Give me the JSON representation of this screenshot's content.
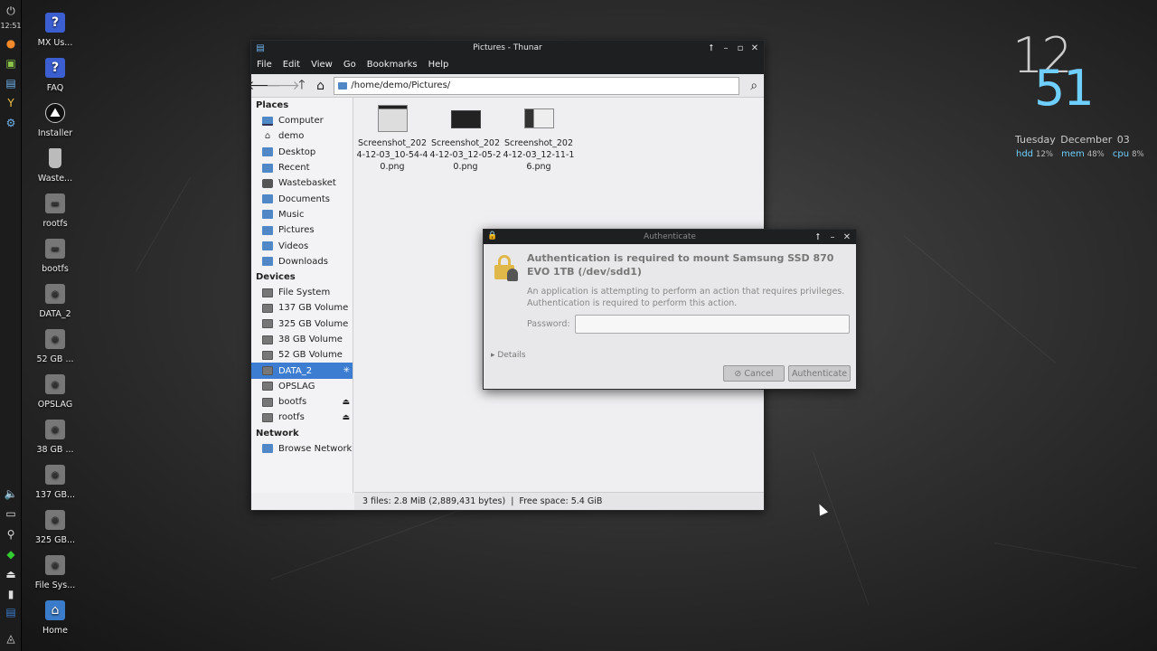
{
  "panel": {
    "clock": "12:51"
  },
  "desktop_icons": [
    {
      "label": "MX Us...",
      "icon": "help-icon",
      "glyph": "?"
    },
    {
      "label": "FAQ",
      "icon": "help-icon",
      "glyph": "?"
    },
    {
      "label": "Installer",
      "icon": "installer-icon",
      "glyph": "⛰"
    },
    {
      "label": "Waste...",
      "icon": "wastebasket-icon",
      "glyph": ""
    },
    {
      "label": "rootfs",
      "icon": "drive-icon",
      "glyph": "▬"
    },
    {
      "label": "bootfs",
      "icon": "drive-icon",
      "glyph": "▬"
    },
    {
      "label": "DATA_2",
      "icon": "drive-icon",
      "glyph": "◉"
    },
    {
      "label": "52 GB ...",
      "icon": "drive-icon",
      "glyph": "◉"
    },
    {
      "label": "OPSLAG",
      "icon": "drive-icon",
      "glyph": "◉"
    },
    {
      "label": "38 GB ...",
      "icon": "drive-icon",
      "glyph": "◉"
    },
    {
      "label": "137 GB...",
      "icon": "drive-icon",
      "glyph": "◉"
    },
    {
      "label": "325 GB...",
      "icon": "drive-icon",
      "glyph": "◉"
    },
    {
      "label": "File Sys...",
      "icon": "drive-icon",
      "glyph": "◉"
    },
    {
      "label": "Home",
      "icon": "home-folder-icon",
      "glyph": "⌂"
    }
  ],
  "conky": {
    "hour": "12",
    "minute": "51",
    "weekday": "Tuesday",
    "date": "December 03",
    "hdd_label": "hdd",
    "hdd_value": "12%",
    "mem_label": "mem",
    "mem_value": "48%",
    "cpu_label": "cpu",
    "cpu_value": "8%"
  },
  "thunar": {
    "title": "Pictures - Thunar",
    "menu": [
      "File",
      "Edit",
      "View",
      "Go",
      "Bookmarks",
      "Help"
    ],
    "location": "/home/demo/Pictures/",
    "sidebar": {
      "places_header": "Places",
      "places": [
        {
          "label": "Computer",
          "icon": "computer-icon"
        },
        {
          "label": "demo",
          "icon": "home-icon"
        },
        {
          "label": "Desktop",
          "icon": "folder-icon"
        },
        {
          "label": "Recent",
          "icon": "folder-icon"
        },
        {
          "label": "Wastebasket",
          "icon": "wastebasket-icon"
        },
        {
          "label": "Documents",
          "icon": "folder-icon"
        },
        {
          "label": "Music",
          "icon": "folder-icon"
        },
        {
          "label": "Pictures",
          "icon": "folder-icon"
        },
        {
          "label": "Videos",
          "icon": "folder-icon"
        },
        {
          "label": "Downloads",
          "icon": "folder-icon"
        }
      ],
      "devices_header": "Devices",
      "devices": [
        {
          "label": "File System",
          "icon": "drive-icon",
          "eject": ""
        },
        {
          "label": "137 GB Volume",
          "icon": "drive-icon",
          "eject": ""
        },
        {
          "label": "325 GB Volume",
          "icon": "drive-icon",
          "eject": ""
        },
        {
          "label": "38 GB Volume",
          "icon": "drive-icon",
          "eject": ""
        },
        {
          "label": "52 GB Volume",
          "icon": "drive-icon",
          "eject": ""
        },
        {
          "label": "DATA_2",
          "icon": "drive-icon",
          "eject": "✳",
          "selected": true
        },
        {
          "label": "OPSLAG",
          "icon": "drive-icon",
          "eject": ""
        },
        {
          "label": "bootfs",
          "icon": "drive-icon",
          "eject": "⏏"
        },
        {
          "label": "rootfs",
          "icon": "drive-icon",
          "eject": "⏏"
        }
      ],
      "network_header": "Network",
      "network": [
        {
          "label": "Browse Network",
          "icon": "network-folder-icon"
        }
      ]
    },
    "files": [
      {
        "name": "Screenshot_2024-12-03_10-54-40.png",
        "line1": "Screenshot_202",
        "line2": "4-12-03_10-54-4",
        "line3": "0.png"
      },
      {
        "name": "Screenshot_2024-12-03_12-05-20.png",
        "line1": "Screenshot_202",
        "line2": "4-12-03_12-05-2",
        "line3": "0.png"
      },
      {
        "name": "Screenshot_2024-12-03_12-11-16.png",
        "line1": "Screenshot_202",
        "line2": "4-12-03_12-11-1",
        "line3": "6.png"
      }
    ],
    "status": "3 files: 2.8 MiB (2,889,431 bytes)  |  Free space: 5.4 GiB"
  },
  "auth": {
    "title": "Authenticate",
    "heading": "Authentication is required to mount Samsung SSD 870 EVO 1TB (/dev/sdd1)",
    "message": "An application is attempting to perform an action that requires privileges. Authentication is required to perform this action.",
    "password_label": "Password:",
    "password_value": "",
    "details_label": "Details",
    "cancel_label": "Cancel",
    "authenticate_label": "Authenticate"
  },
  "colors": {
    "accent": "#3c7dd1",
    "titlebar": "#1d1f21",
    "conky_blue": "#6fd0ff"
  }
}
